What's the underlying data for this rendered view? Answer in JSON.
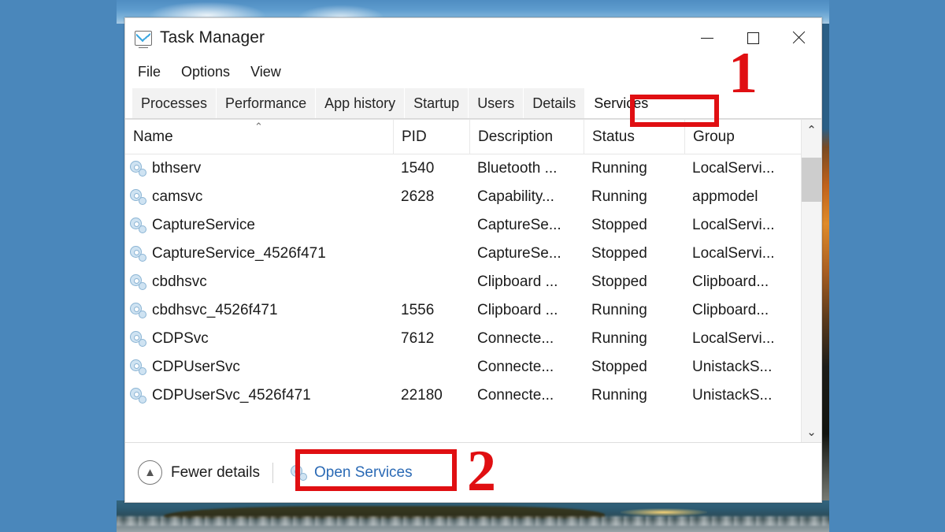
{
  "window": {
    "title": "Task Manager",
    "app_icon": "task-manager-icon",
    "controls": {
      "minimize": "minimize-icon",
      "maximize": "maximize-icon",
      "close": "close-icon"
    }
  },
  "menubar": {
    "items": [
      {
        "label": "File"
      },
      {
        "label": "Options"
      },
      {
        "label": "View"
      }
    ]
  },
  "tabs": [
    {
      "label": "Processes",
      "active": false
    },
    {
      "label": "Performance",
      "active": false
    },
    {
      "label": "App history",
      "active": false
    },
    {
      "label": "Startup",
      "active": false
    },
    {
      "label": "Users",
      "active": false
    },
    {
      "label": "Details",
      "active": false
    },
    {
      "label": "Services",
      "active": true
    }
  ],
  "table": {
    "columns": [
      {
        "key": "name",
        "label": "Name",
        "sorted": true,
        "sort_caret": "⌃"
      },
      {
        "key": "pid",
        "label": "PID",
        "sorted": false
      },
      {
        "key": "description",
        "label": "Description",
        "sorted": false
      },
      {
        "key": "status",
        "label": "Status",
        "sorted": false
      },
      {
        "key": "group",
        "label": "Group",
        "sorted": false
      }
    ],
    "rows": [
      {
        "icon": "service-icon",
        "name": "bthserv",
        "pid": "1540",
        "description": "Bluetooth ...",
        "status": "Running",
        "group": "LocalServi..."
      },
      {
        "icon": "service-icon",
        "name": "camsvc",
        "pid": "2628",
        "description": "Capability...",
        "status": "Running",
        "group": "appmodel"
      },
      {
        "icon": "service-icon",
        "name": "CaptureService",
        "pid": "",
        "description": "CaptureSe...",
        "status": "Stopped",
        "group": "LocalServi..."
      },
      {
        "icon": "service-icon",
        "name": "CaptureService_4526f471",
        "pid": "",
        "description": "CaptureSe...",
        "status": "Stopped",
        "group": "LocalServi..."
      },
      {
        "icon": "service-icon",
        "name": "cbdhsvc",
        "pid": "",
        "description": "Clipboard ...",
        "status": "Stopped",
        "group": "Clipboard..."
      },
      {
        "icon": "service-icon",
        "name": "cbdhsvc_4526f471",
        "pid": "1556",
        "description": "Clipboard ...",
        "status": "Running",
        "group": "Clipboard..."
      },
      {
        "icon": "service-icon",
        "name": "CDPSvc",
        "pid": "7612",
        "description": "Connecte...",
        "status": "Running",
        "group": "LocalServi..."
      },
      {
        "icon": "service-icon",
        "name": "CDPUserSvc",
        "pid": "",
        "description": "Connecte...",
        "status": "Stopped",
        "group": "UnistackS..."
      },
      {
        "icon": "service-icon",
        "name": "CDPUserSvc_4526f471",
        "pid": "22180",
        "description": "Connecte...",
        "status": "Running",
        "group": "UnistackS..."
      }
    ]
  },
  "scrollbar": {
    "up_arrow": "⌃",
    "down_arrow": "⌄"
  },
  "footer": {
    "fewer_details_label": "Fewer details",
    "fewer_details_icon": "chevron-up-icon",
    "open_services_label": "Open Services",
    "open_services_icon": "service-icon"
  },
  "annotations": [
    {
      "id": "1",
      "target": "Services",
      "number": "1",
      "color": "#e00f12"
    },
    {
      "id": "2",
      "target": "Open Services",
      "number": "2",
      "color": "#e00f12"
    }
  ],
  "colors": {
    "desktop": "#4a87bb",
    "annotation_red": "#e00f12",
    "link_blue": "#2b6ab5",
    "tab_inactive": "#f2f2f2"
  }
}
